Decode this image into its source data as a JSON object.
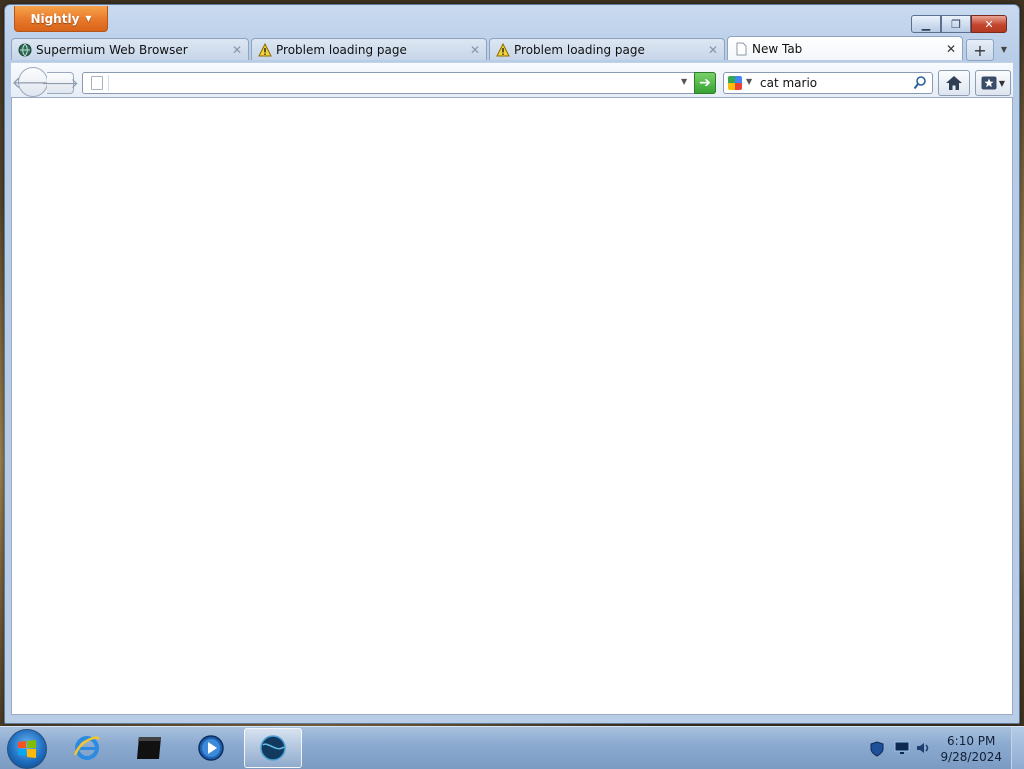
{
  "window": {
    "app_menu_label": "Nightly",
    "controls": {
      "minimize": "minimize",
      "maximize": "maximize",
      "close": "close"
    }
  },
  "tabs": [
    {
      "label": "Supermium Web Browser",
      "icon": "globe-icon",
      "active": false
    },
    {
      "label": "Problem loading page",
      "icon": "warning-icon",
      "active": false
    },
    {
      "label": "Problem loading page",
      "icon": "warning-icon",
      "active": false
    },
    {
      "label": "New Tab",
      "icon": "page-icon",
      "active": true
    }
  ],
  "navbar": {
    "url_value": "",
    "search_value": "cat mario",
    "search_engine": "google-icon"
  },
  "taskbar": {
    "time": "6:10 PM",
    "date": "9/28/2024",
    "apps": [
      "internet-explorer-icon",
      "terminal-icon",
      "media-player-icon",
      "browser-globe-icon"
    ]
  },
  "colors": {
    "app_button": "#e8782a",
    "go_button": "#36a232",
    "taskbar": "#8aa9cf"
  }
}
